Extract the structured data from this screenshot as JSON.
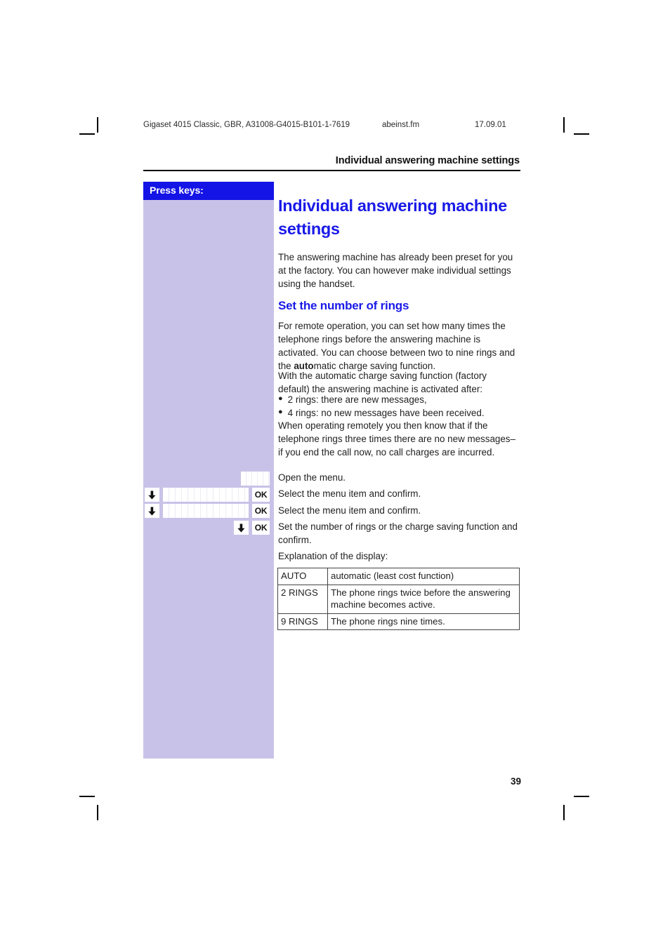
{
  "folio": {
    "doc_id": "Gigaset 4015 Classic, GBR, A31008-G4015-B101-1-7619",
    "file_name": "abeinst.fm",
    "date": "17.09.01"
  },
  "running_head": "Individual answering machine settings",
  "sidebar": {
    "header_label": "Press keys:",
    "header_bg": "#1414e6",
    "body_bg": "#c9c2e8",
    "rows": [
      {
        "name": "open-menu",
        "glyphs": [
          "display-sm"
        ]
      },
      {
        "name": "select-menu-1",
        "glyphs": [
          "arrow-down",
          "display",
          "ok"
        ]
      },
      {
        "name": "select-menu-2",
        "glyphs": [
          "arrow-down",
          "display",
          "ok"
        ]
      },
      {
        "name": "set-rings",
        "glyphs": [
          "arrow-down",
          "ok"
        ]
      }
    ],
    "ok_label": "OK"
  },
  "content": {
    "title": "Individual answering machine settings",
    "intro": "The answering machine has already been preset for you at the factory. You can however make individual settings using the handset.",
    "subhead": "Set the number of rings",
    "para1_pre": "For remote operation, you can set how many times the telephone rings before the answering machine is activated. You can choose between two to nine rings and the ",
    "para1_bold": "auto",
    "para1_post": "matic charge saving function.",
    "para2": "With the automatic charge saving function (factory default) the answering machine is activated after:",
    "bullets": [
      "2 rings: there are new messages,",
      "4 rings: no new messages have been received."
    ],
    "para3": "When operating remotely you then know that if the telephone rings three times there are no new messages–  if you end the call now, no call charges are incurred.",
    "steps": [
      "Open the menu.",
      "Select the menu item and confirm.",
      "Select the menu item and confirm.",
      "Set the number of rings or the charge saving function and confirm."
    ],
    "table_caption": "Explanation of the display:",
    "table_rows": [
      {
        "key": "AUTO",
        "desc": "automatic (least cost function)"
      },
      {
        "key": "2 RINGS",
        "desc": "The phone rings twice before the answering machine becomes active."
      },
      {
        "key": "9 RINGS",
        "desc": "The phone rings nine times."
      }
    ]
  },
  "page_number": "39",
  "colors": {
    "heading_blue": "#1919e8",
    "sidebar_head_blue": "#1414e6",
    "sidebar_lavender": "#c9c2e8",
    "text": "#1f1f1f"
  }
}
